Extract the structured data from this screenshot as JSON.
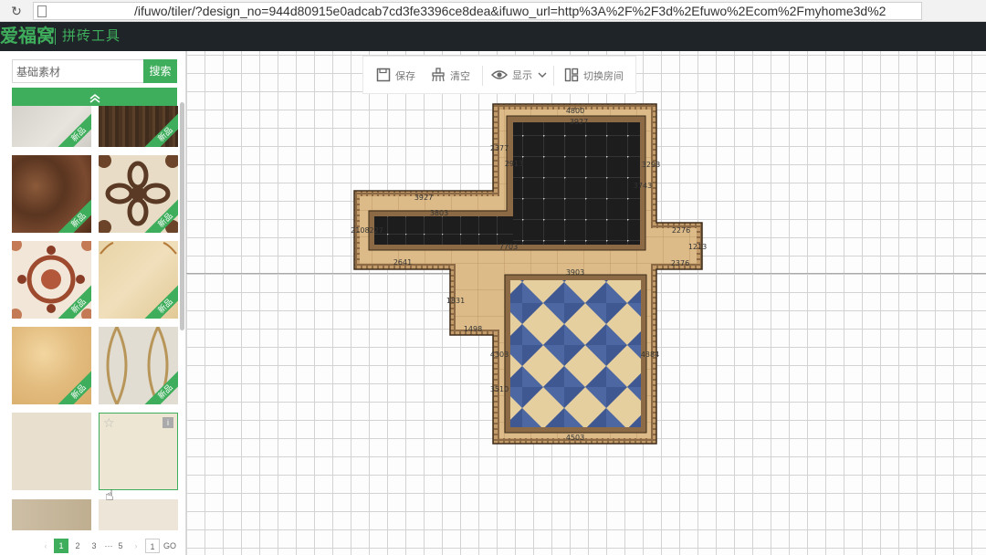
{
  "browser": {
    "reload_icon": "reload-icon",
    "url": "/ifuwo/tiler/?design_no=944d80915e0adcab7cd3fe3396ce8dea&ifuwo_url=http%3A%2F%2F3d%2Efuwo%2Ecom%2Fmyhome3d%2"
  },
  "header": {
    "logo": "爱福窝",
    "tool_title": "拼砖工具"
  },
  "sidebar": {
    "search_value": "基础素材",
    "search_button": "搜索",
    "collapse_icon": "chevron-up-double-icon",
    "tiles": [
      {
        "name": "light-gray-marble",
        "badge": "新品"
      },
      {
        "name": "dark-wood",
        "badge": "新品"
      },
      {
        "name": "brown-marble",
        "badge": "新品"
      },
      {
        "name": "floral-medallion",
        "badge": "新品"
      },
      {
        "name": "red-medallion",
        "badge": "新品"
      },
      {
        "name": "beige-corner-ornament",
        "badge": "新品"
      },
      {
        "name": "golden-marble",
        "badge": "新品"
      },
      {
        "name": "gold-lattice",
        "badge": "新品"
      },
      {
        "name": "plain-cream",
        "badge": ""
      },
      {
        "name": "pale-cream-selected",
        "badge": ""
      },
      {
        "name": "brown-stone",
        "badge": ""
      },
      {
        "name": "pale-beige",
        "badge": ""
      }
    ],
    "pagination": {
      "pages": [
        "1",
        "2",
        "3",
        "···",
        "5"
      ],
      "current": "1",
      "goto_value": "1",
      "goto_button": "GO"
    }
  },
  "toolbar": {
    "save": "保存",
    "clear": "清空",
    "display": "显示",
    "switch_room": "切换房间"
  },
  "plan": {
    "colors": {
      "outer_border": "#7a5a38",
      "beige": "#d9b98a",
      "black_tile": "#1c1c1c",
      "blue_tile": "#4a66a0",
      "cream_tile": "#e6cf9e"
    },
    "dimensions": {
      "top_outer": "4800",
      "top_inner": "3927",
      "left_step_1": "2377",
      "left_step_2": "2913",
      "right_top_1": "3293",
      "right_top_2": "3743",
      "mid_left_1": "3927",
      "mid_left_2": "3803",
      "far_left": "2108227",
      "mid_bottom": "7703",
      "right_ext_1": "2276",
      "right_ext_2": "1213",
      "right_ext_3": "2376",
      "lower_left": "2641",
      "lower_top": "3903",
      "lower_side_1": "1831",
      "lower_side_2": "1498",
      "lower_inner_left": "4303",
      "lower_inner_left_2": "3510",
      "lower_right": "4384",
      "bottom": "4503"
    }
  }
}
